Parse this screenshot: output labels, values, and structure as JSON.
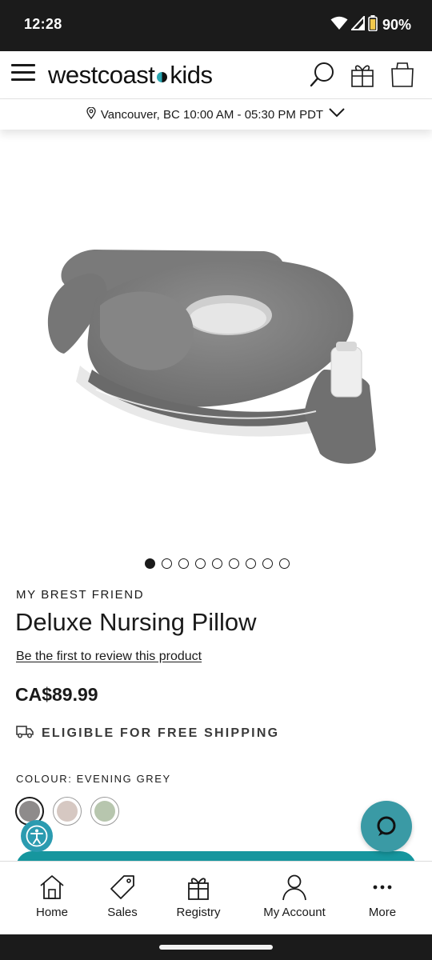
{
  "status_bar": {
    "time": "12:28",
    "battery": "90%",
    "icons": [
      "wifi-icon",
      "signal-icon",
      "battery-icon"
    ]
  },
  "header": {
    "logo": {
      "left": "westcoast",
      "right": "kids"
    },
    "icons": [
      "menu-icon",
      "search-icon",
      "gift-icon",
      "bag-icon"
    ]
  },
  "location": {
    "text": "Vancouver, BC 10:00 AM - 05:30 PM PDT",
    "icons": [
      "location-pin-icon",
      "chevron-down-icon"
    ]
  },
  "carousel": {
    "total": 9,
    "active_index": 0
  },
  "product": {
    "brand": "MY BREST FRIEND",
    "title": "Deluxe Nursing Pillow",
    "review_link": "Be the first to review this product",
    "price": "CA$89.99",
    "shipping": "ELIGIBLE FOR FREE SHIPPING",
    "colour_label": "COLOUR: EVENING GREY",
    "swatches": [
      {
        "color": "#8e8b8b",
        "selected": true
      },
      {
        "color": "#d6c8c2",
        "selected": false
      },
      {
        "color": "#b7c6ae",
        "selected": false
      }
    ]
  },
  "colors": {
    "accent": "#16969e",
    "chat": "#3a9aa5",
    "accessibility": "#2b9bb0"
  },
  "bottom_nav": {
    "items": [
      {
        "label": "Home",
        "icon": "home-icon"
      },
      {
        "label": "Sales",
        "icon": "tag-icon"
      },
      {
        "label": "Registry",
        "icon": "gift-icon"
      },
      {
        "label": "My Account",
        "icon": "user-icon"
      },
      {
        "label": "More",
        "icon": "more-dots-icon"
      }
    ]
  }
}
